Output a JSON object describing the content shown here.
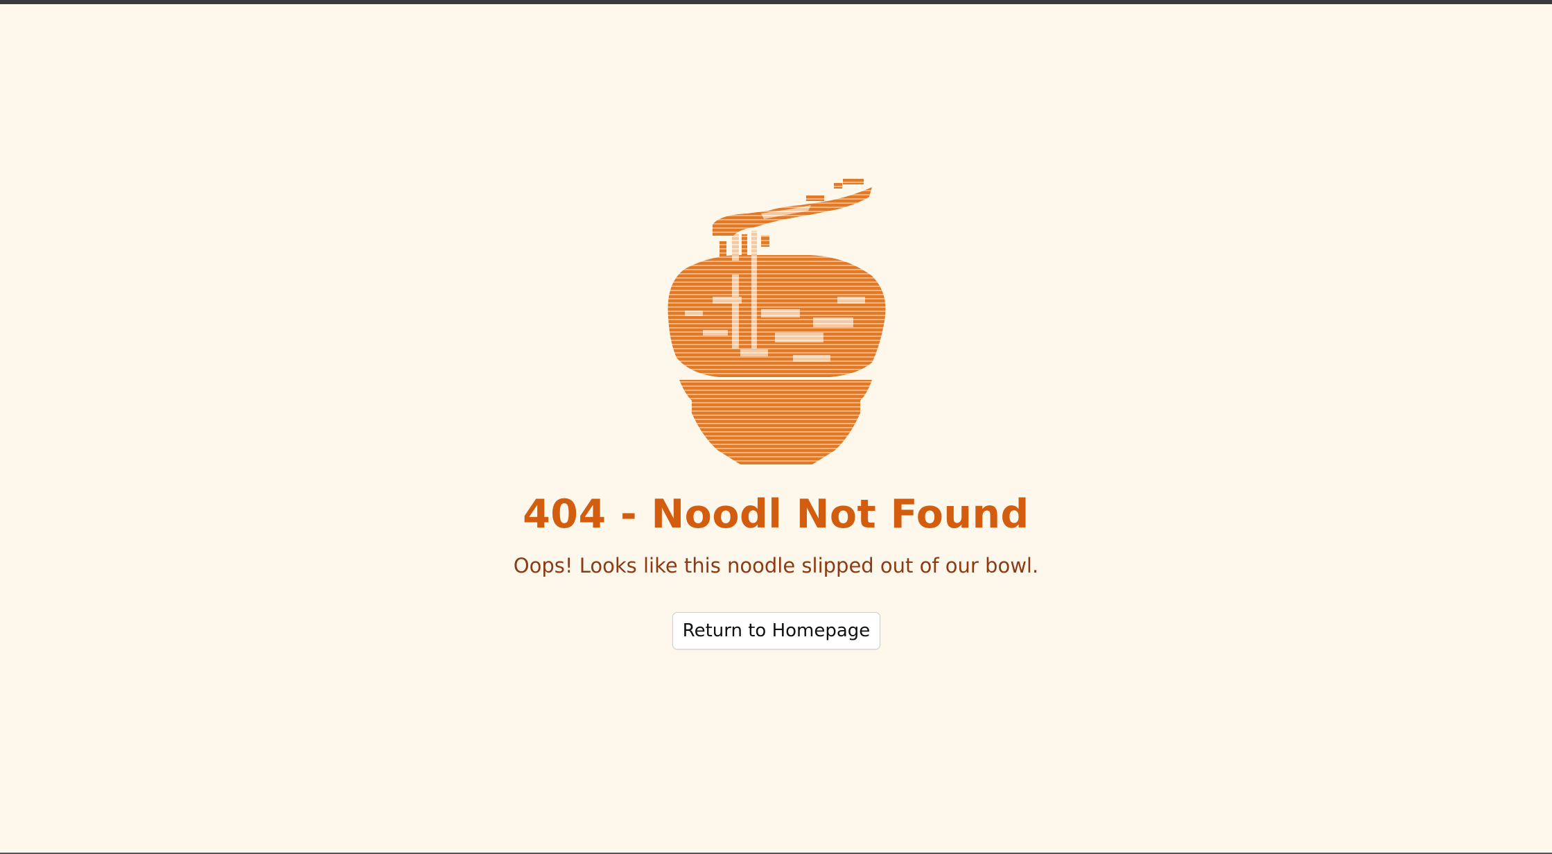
{
  "colors": {
    "background": "#fef7ec",
    "accent": "#d35d0e",
    "subtitle": "#8a3b14",
    "art_primary": "#e07a26",
    "art_light": "#f5d5b5"
  },
  "illustration": {
    "icon": "noodle-bowl-icon"
  },
  "error": {
    "title": "404 - Noodl Not Found",
    "message": "Oops! Looks like this noodle slipped out of our bowl."
  },
  "actions": {
    "home_label": "Return to Homepage"
  }
}
